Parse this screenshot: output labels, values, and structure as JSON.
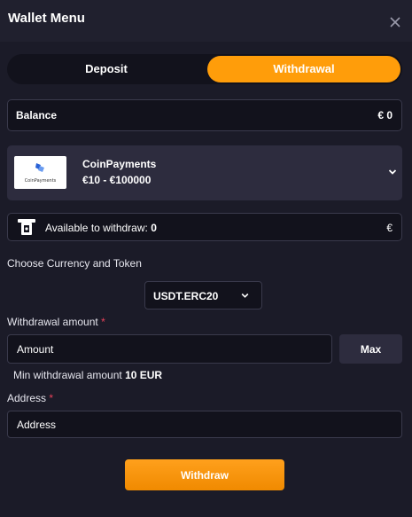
{
  "window": {
    "title": "Wallet Menu",
    "close_icon": "close-icon"
  },
  "tabs": [
    {
      "label": "Deposit",
      "active": false
    },
    {
      "label": "Withdrawal",
      "active": true
    }
  ],
  "balance": {
    "label": "Balance",
    "value": "€ 0"
  },
  "payment_method": {
    "name": "CoinPayments",
    "range": "€10 - €100000",
    "logo_text": "CoinPayments",
    "icon": "chevron-down-icon"
  },
  "available": {
    "icon": "atm-withdraw-icon",
    "label": "Available to withdraw: ",
    "value": "0",
    "currency": "€"
  },
  "currency": {
    "label": "Choose Currency and Token",
    "selected": "USDT.ERC20"
  },
  "amount": {
    "label": "Withdrawal amount",
    "required_marker": "*",
    "placeholder": "Amount",
    "max_label": "Max",
    "min_note_prefix": "Min withdrawal amount ",
    "min_note_value": "10 EUR"
  },
  "address": {
    "label": "Address",
    "required_marker": "*",
    "placeholder": "Address"
  },
  "submit_label": "Withdraw",
  "colors": {
    "accent": "#ff9d0a",
    "background": "#1b1b28",
    "panel": "#2d2c3e",
    "required": "#e8425a"
  }
}
